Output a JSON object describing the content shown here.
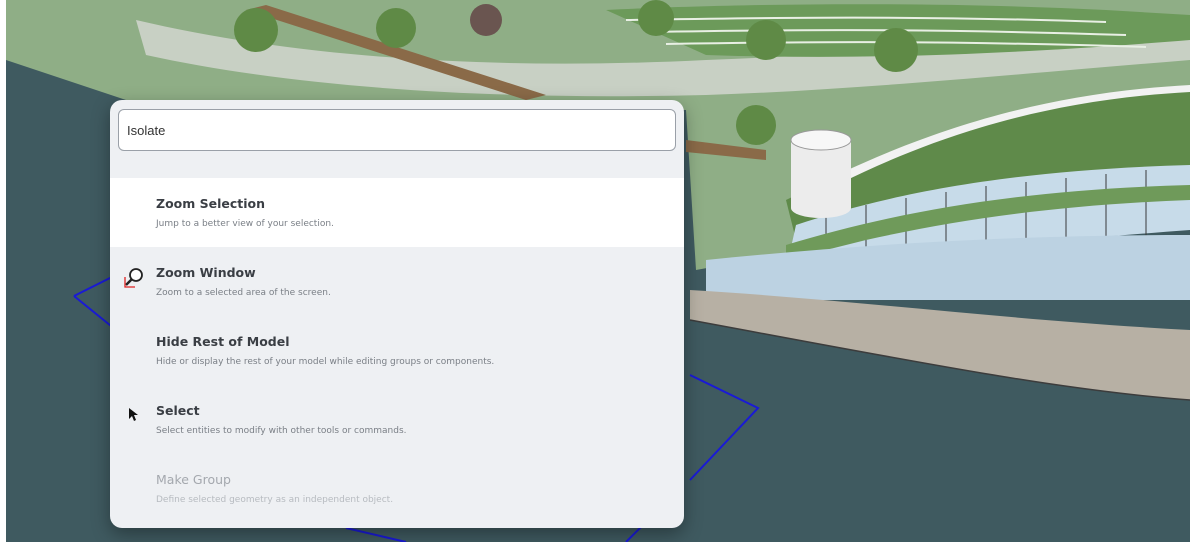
{
  "search": {
    "query": "Isolate"
  },
  "results": [
    {
      "title": "Zoom Selection",
      "description": "Jump to a better view of your selection.",
      "icon": "none",
      "highlighted": true,
      "disabled": false
    },
    {
      "title": "Zoom Window",
      "description": "Zoom to a selected area of the screen.",
      "icon": "zoom-window-icon",
      "highlighted": false,
      "disabled": false
    },
    {
      "title": "Hide Rest of Model",
      "description": "Hide or display the rest of your model while editing groups or components.",
      "icon": "none",
      "highlighted": false,
      "disabled": false
    },
    {
      "title": "Select",
      "description": "Select entities to modify with other tools or commands.",
      "icon": "select-arrow-icon",
      "highlighted": false,
      "disabled": false
    },
    {
      "title": "Make Group",
      "description": "Define selected geometry as an independent object.",
      "icon": "none",
      "highlighted": false,
      "disabled": true
    }
  ],
  "colors": {
    "palette_bg": "#eef0f3",
    "highlight_bg": "#ffffff",
    "water": "#3f5a60",
    "grass": "#7fa36f",
    "selection_outline": "#1a1ad6"
  }
}
